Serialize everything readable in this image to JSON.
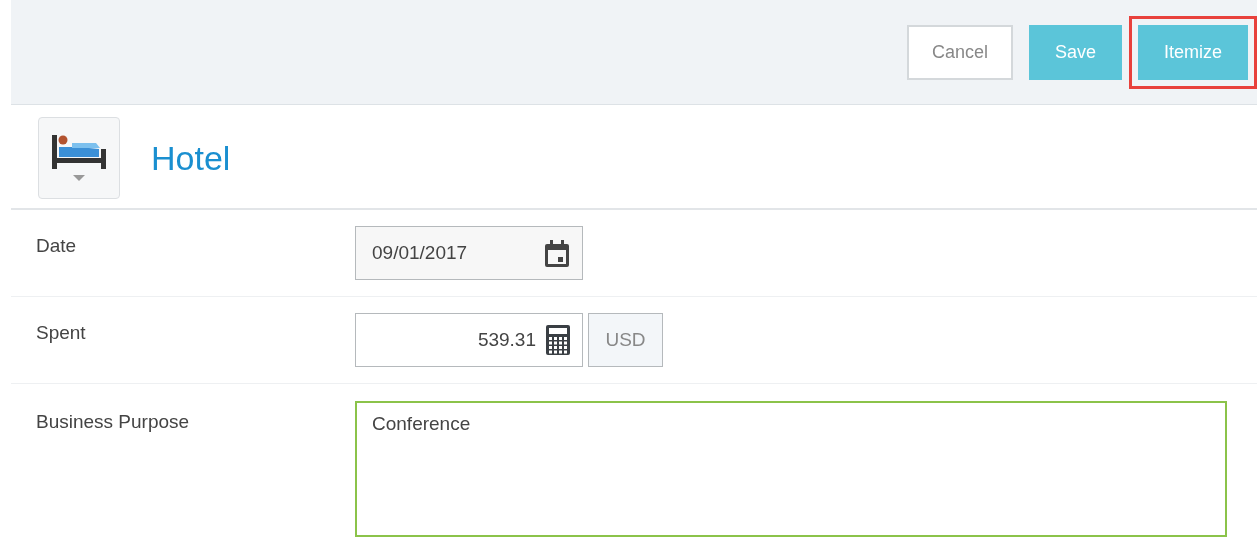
{
  "toolbar": {
    "buttons": [
      {
        "label": "Cancel",
        "kind": "secondary",
        "highlighted": false
      },
      {
        "label": "Save",
        "kind": "primary",
        "highlighted": false
      },
      {
        "label": "Itemize",
        "kind": "primary",
        "highlighted": true
      }
    ]
  },
  "expense_type": {
    "title": "Hotel"
  },
  "fields": [
    {
      "label": "Date",
      "kind": "date",
      "value": "09/01/2017"
    },
    {
      "label": "Spent",
      "kind": "amount",
      "value": "539.31",
      "currency": "USD"
    },
    {
      "label": "Business Purpose",
      "kind": "textarea",
      "value": "Conference"
    }
  ]
}
